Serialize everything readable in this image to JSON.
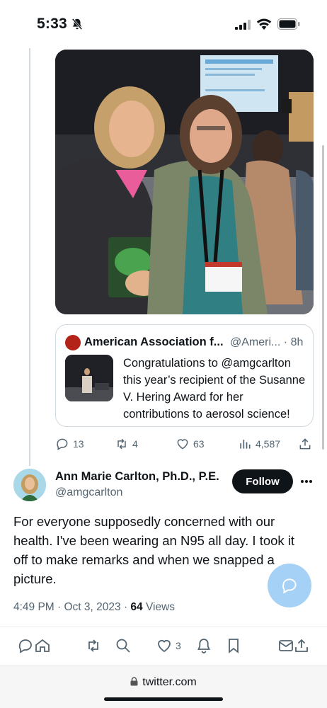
{
  "status_bar": {
    "time": "5:33"
  },
  "quoted_tweet": {
    "author_name": "American Association f...",
    "handle_time": "@Ameri... · 8h",
    "text": "Congratulations to @amgcarlton this year’s recipient of the Susanne V. Hering Award for her contributions to aerosol science!"
  },
  "actions": {
    "replies": "13",
    "retweets": "4",
    "likes": "63",
    "views": "4,587"
  },
  "tweet": {
    "author_name": "Ann Marie Carlton, Ph.D., P.E.",
    "author_handle": "@amgcarlton",
    "follow_label": "Follow",
    "text": "For everyone supposedly concerned with our health. I've been wearing an N95 all day. I took it off to make remarks and when we snapped a picture.",
    "timestamp": "4:49 PM · Oct 3, 2023 · ",
    "views_count": "64",
    "views_label": " Views"
  },
  "toolbar": {
    "likes_count": "3"
  },
  "browser": {
    "url": "twitter.com"
  },
  "colors": {
    "accent": "#1d9bf0",
    "fab": "#a4d1f5",
    "text": "#0f1419",
    "muted": "#536471"
  }
}
